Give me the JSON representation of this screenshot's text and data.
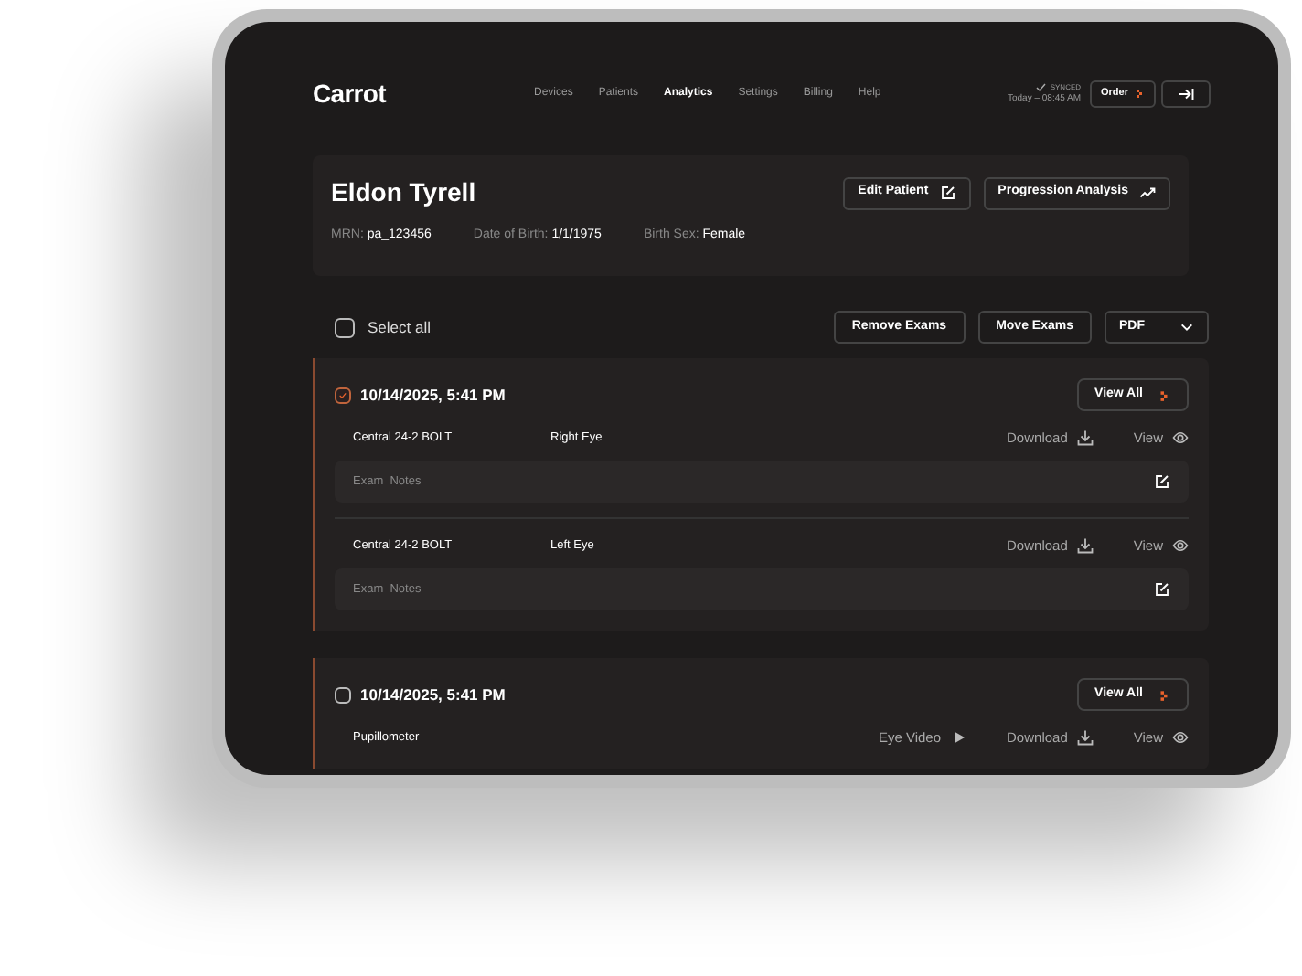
{
  "header": {
    "logo": "Carrot",
    "nav": [
      {
        "label": "Devices",
        "selected": false
      },
      {
        "label": "Patients",
        "selected": false
      },
      {
        "label": "Analytics",
        "selected": true
      },
      {
        "label": "Settings",
        "selected": false
      },
      {
        "label": "Billing",
        "selected": false
      },
      {
        "label": "Help",
        "selected": false
      }
    ],
    "sync": {
      "status": "SYNCED",
      "time": "Today – 08:45 AM"
    },
    "order_button": "Order"
  },
  "patient": {
    "name": "Eldon Tyrell",
    "fields": [
      {
        "label": "MRN:",
        "value": "pa_123456"
      },
      {
        "label": "Date of Birth:",
        "value": "1/1/1975"
      },
      {
        "label": "Birth Sex:",
        "value": "Female"
      }
    ],
    "buttons": [
      {
        "kind": "edit",
        "label": "Edit Patient"
      },
      {
        "kind": "trend",
        "label": "Progression Analysis"
      }
    ]
  },
  "toolbar": {
    "select_all": {
      "label": "Select all",
      "checked": false
    },
    "buttons": [
      "Remove Exams",
      "Move Exams"
    ],
    "format": "PDF"
  },
  "exam_groups": [
    {
      "date": "10/14/2025, 5:41 PM",
      "checked": true,
      "view_all": "View All",
      "exams": [
        {
          "name": "Central 24-2 BOLT",
          "eye": "Right Eye",
          "actions": [
            {
              "kind": "download",
              "label": "Download"
            },
            {
              "kind": "view",
              "label": "View"
            }
          ],
          "notes": "Exam  Notes"
        },
        {
          "name": "Central 24-2 BOLT",
          "eye": "Left Eye",
          "actions": [
            {
              "kind": "download",
              "label": "Download"
            },
            {
              "kind": "view",
              "label": "View"
            }
          ],
          "notes": "Exam  Notes"
        }
      ]
    },
    {
      "date": "10/14/2025, 5:41 PM",
      "checked": false,
      "view_all": "View All",
      "exams": [
        {
          "name": "Pupillometer",
          "actions": [
            {
              "kind": "video",
              "label": "Eye Video"
            },
            {
              "kind": "download",
              "label": "Download"
            },
            {
              "kind": "view",
              "label": "View"
            }
          ]
        }
      ]
    }
  ]
}
